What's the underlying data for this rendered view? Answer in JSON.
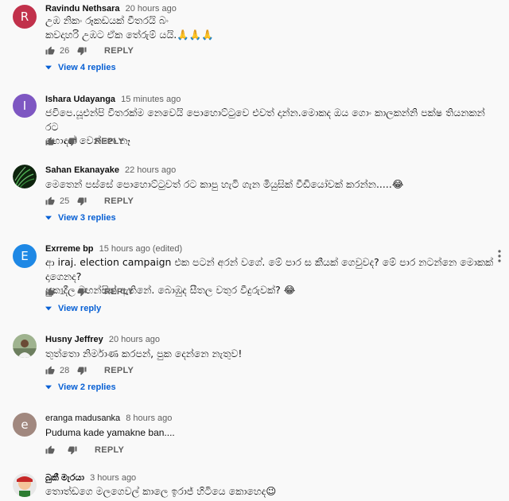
{
  "comments": [
    {
      "author": "Ravindu Nethsara",
      "time": "20 hours ago",
      "avatar_letter": "R",
      "avatar_color": "#c1314b",
      "text_lines": [
        "උඹ නිකං රූකඩයක් වීතරයි බං",
        "කවදාහරි උඹට ඒක තේරුම් යයි.🙏🙏🙏"
      ],
      "likes": "26",
      "reply_label": "REPLY",
      "view_replies": "View 4 replies"
    },
    {
      "author": "Ishara Udayanga",
      "time": "15 minutes ago",
      "avatar_letter": "I",
      "avatar_color": "#7e57c2",
      "text_lines": [
        "ජවිපෙ.යූඑන්පි වීතරක්ම නෙවෙයි පොහොට්ටුවෙ එවත් දාන්න.මොකද ඔය ගොං කාලකන්නි පක්ෂ තියනකන් රට",
        "හොඳක් වෙන්නෙ නෑ"
      ],
      "likes": "",
      "reply_label": "REPLY",
      "view_replies": ""
    },
    {
      "author": "Sahan Ekanayake",
      "time": "22 hours ago",
      "avatar_letter": "",
      "avatar_color": "#173617",
      "text_lines": [
        "මෙතෙන් පස්සේ පොහොට්ටුවත් රට කාපු හැටි ගැන මියුසික් වීඩියෝවක් කරන්න.....😂"
      ],
      "likes": "25",
      "reply_label": "REPLY",
      "view_replies": "View 3 replies"
    },
    {
      "author": "Exrreme bp",
      "time": "15 hours ago (edited)",
      "avatar_letter": "E",
      "avatar_color": "#1e88e5",
      "text_lines": [
        "ආ iraj. election campaign එක පටන් අරන් වගේ. මේ පාර ස කීයක් ගෙවුවද? මේ පාර නටන්නෙ මොකක් දාගෙනද?",
        "පුක දීල මහන්සිත් ඇතිනේ. බොඹුද සීතල වතුර වීදුරුවක්? 😂"
      ],
      "likes": "1",
      "reply_label": "REPLY",
      "view_replies": "View reply"
    },
    {
      "author": "Husny Jeffrey",
      "time": "20 hours ago",
      "avatar_letter": "",
      "avatar_color": "#8a9a7a",
      "text_lines": [
        "තුත්තො නිර්මාණ කරපන්, පුක දෙන්නෙ නැතුව!"
      ],
      "likes": "28",
      "reply_label": "REPLY",
      "view_replies": "View 2 replies"
    },
    {
      "author": "eranga madusanka",
      "time": "8 hours ago",
      "avatar_letter": "e",
      "avatar_color": "#a1887f",
      "text_lines": [
        "Puduma kade yamakne ban...."
      ],
      "likes": "",
      "reply_label": "REPLY",
      "view_replies": ""
    },
    {
      "author": "බුකී මැරයා",
      "time": "3 hours ago",
      "avatar_letter": "",
      "avatar_color": "#c62828",
      "text_lines": [
        "තොත්ඩගෙ මලගෙවල් කාලෙ ඉරාජ් හිටියෙ කොහෙද😉"
      ],
      "likes": "",
      "reply_label": "",
      "view_replies": ""
    }
  ]
}
